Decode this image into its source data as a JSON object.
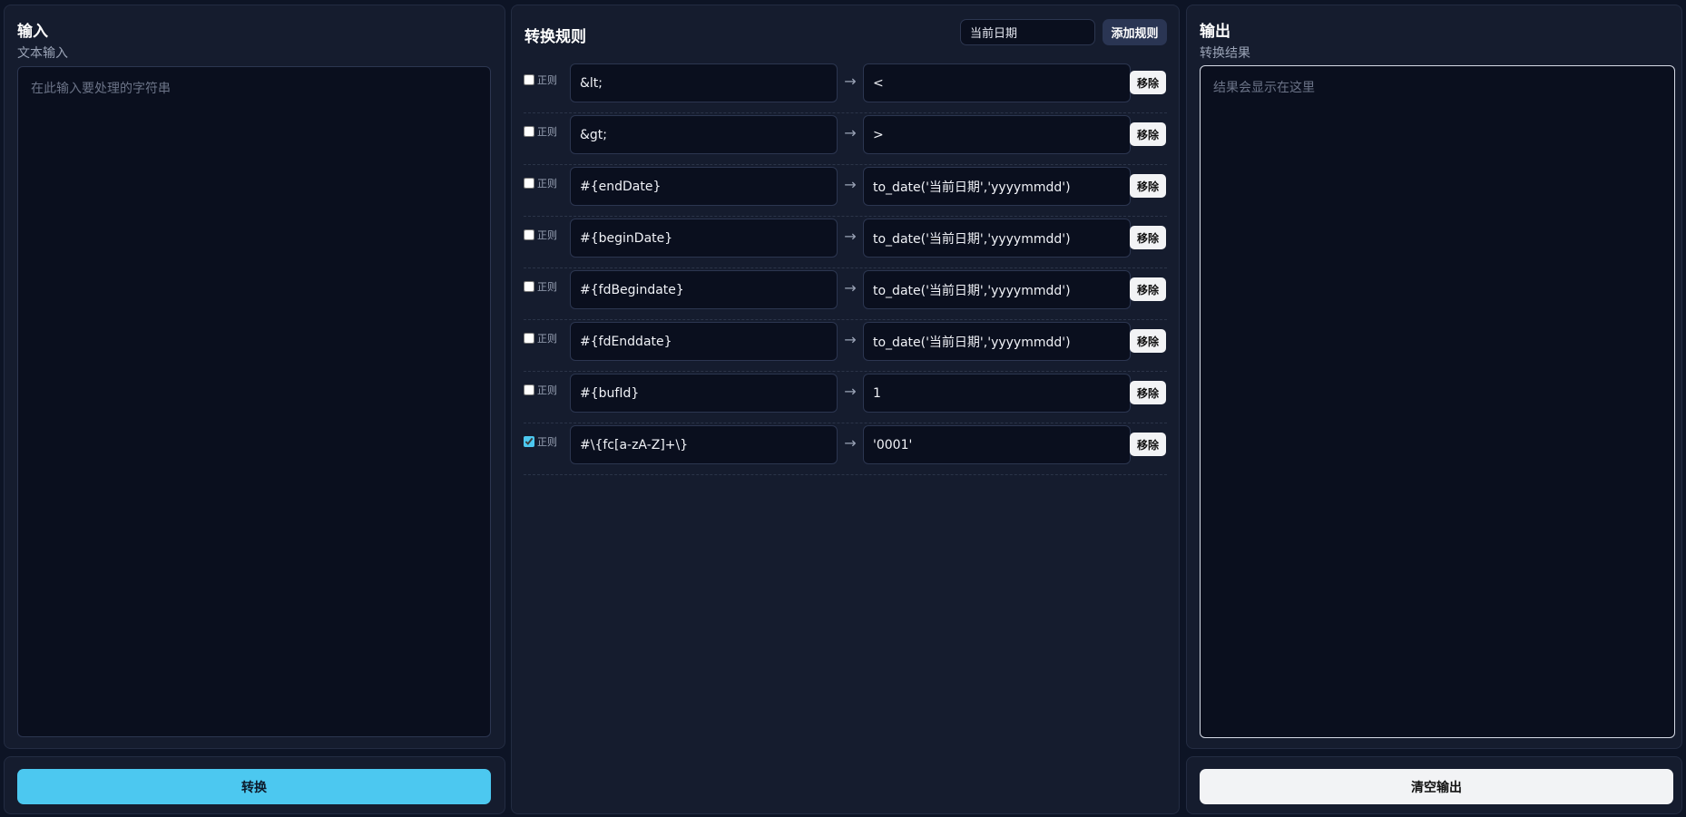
{
  "input_panel": {
    "title": "输入",
    "subtitle": "文本输入",
    "placeholder": "在此输入要处理的字符串",
    "convert_label": "转换"
  },
  "rules_panel": {
    "title": "转换规则",
    "date_value": "当前日期",
    "add_label": "添加规则",
    "regex_label": "正则",
    "arrow": "→",
    "remove_label": "移除",
    "rules": [
      {
        "regex": false,
        "source": "&lt;",
        "target": "<"
      },
      {
        "regex": false,
        "source": "&gt;",
        "target": ">"
      },
      {
        "regex": false,
        "source": "#{endDate}",
        "target": "to_date('当前日期','yyyymmdd')"
      },
      {
        "regex": false,
        "source": "#{beginDate}",
        "target": "to_date('当前日期','yyyymmdd')"
      },
      {
        "regex": false,
        "source": "#{fdBegindate}",
        "target": "to_date('当前日期','yyyymmdd')"
      },
      {
        "regex": false,
        "source": "#{fdEnddate}",
        "target": "to_date('当前日期','yyyymmdd')"
      },
      {
        "regex": false,
        "source": "#{bufId}",
        "target": "1"
      },
      {
        "regex": true,
        "source": "#\\{fc[a-zA-Z]+\\}",
        "target": "'0001'"
      }
    ]
  },
  "output_panel": {
    "title": "输出",
    "subtitle": "转换结果",
    "placeholder": "结果会显示在这里",
    "clear_label": "清空输出"
  },
  "colors": {
    "accent": "#4cc8f0",
    "background": "#0d1425",
    "panel": "#151c2e"
  }
}
